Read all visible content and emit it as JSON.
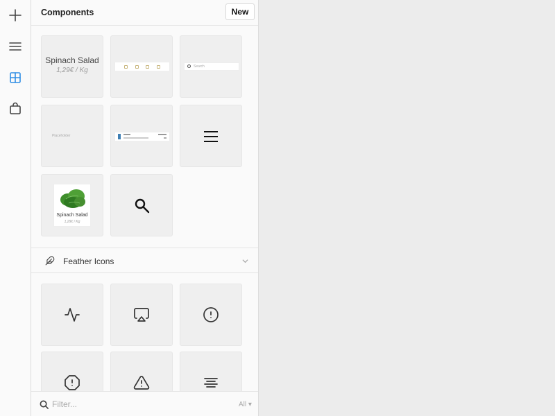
{
  "toolbar": {
    "items": [
      {
        "icon": "plus-icon",
        "active": false
      },
      {
        "icon": "menu-icon",
        "active": false
      },
      {
        "icon": "grid-icon",
        "active": true
      },
      {
        "icon": "bag-icon",
        "active": false
      }
    ],
    "accent_color": "#2f8ee5"
  },
  "panel": {
    "title": "Components",
    "new_button": "New"
  },
  "components": {
    "spinach_title": "Spinach Salad",
    "spinach_price": "1,29€ / Kg",
    "search_placeholder": "Search",
    "placeholder_text": "Placeholder",
    "card_title": "Spinach Salad",
    "card_price": "1,29€ / Kg"
  },
  "section": {
    "label": "Feather Icons",
    "icons": [
      "activity-icon",
      "airplay-icon",
      "alert-circle-icon",
      "alert-octagon-icon",
      "alert-triangle-icon",
      "align-center-icon"
    ]
  },
  "footer": {
    "filter_placeholder": "Filter...",
    "filter_select": "All"
  }
}
